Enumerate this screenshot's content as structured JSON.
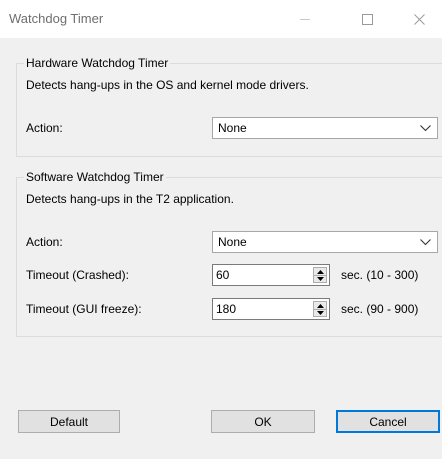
{
  "window": {
    "title": "Watchdog Timer"
  },
  "hardware": {
    "legend": "Hardware Watchdog Timer",
    "description": "Detects hang-ups in the OS and kernel mode drivers.",
    "action_label": "Action:",
    "action_value": "None"
  },
  "software": {
    "legend": "Software Watchdog Timer",
    "description": "Detects hang-ups in the T2 application.",
    "action_label": "Action:",
    "action_value": "None",
    "timeout_crashed_label": "Timeout (Crashed):",
    "timeout_crashed_value": "60",
    "timeout_crashed_range": "sec. (10 - 300)",
    "timeout_gui_label": "Timeout (GUI freeze):",
    "timeout_gui_value": "180",
    "timeout_gui_range": "sec. (90 - 900)"
  },
  "buttons": {
    "default": "Default",
    "ok": "OK",
    "cancel": "Cancel"
  },
  "colors": {
    "focus_accent": "#0078d7",
    "dialog_background": "#f0f0f0"
  },
  "icons": {
    "minimize": "minimize-icon",
    "maximize": "maximize-icon",
    "close": "close-icon",
    "dropdown": "chevron-down-icon",
    "spin_up": "triangle-up-icon",
    "spin_down": "triangle-down-icon"
  }
}
